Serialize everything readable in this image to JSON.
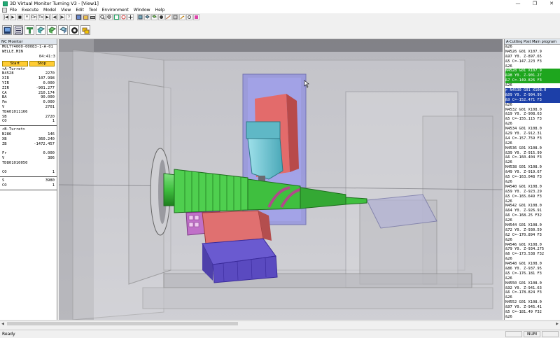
{
  "window": {
    "title": "3D Virtual Monitor Turning V3 - [View1]",
    "controls": [
      "—",
      "❐",
      "✕"
    ]
  },
  "menu": [
    "File",
    "Execute",
    "Model",
    "View",
    "Edit",
    "Tool",
    "Environment",
    "Window",
    "Help"
  ],
  "toolbar1": {
    "buttons": [
      "|◀",
      "▶",
      "■",
      "⏸",
      "On",
      "Tx",
      "▶|",
      "◀|",
      "|▶",
      "?"
    ]
  },
  "nc_monitor": {
    "title": "NC Monitor",
    "program": "MULTY4000-00083-1-A-01",
    "file": "WELLE.MIN",
    "time": "04:41:3",
    "start_label": "Start",
    "stop_label": "Stop",
    "a_turret_label": "<A-Turret>",
    "a_turret": [
      [
        "N4528",
        "2270"
      ],
      [
        "XIR",
        "107.998"
      ],
      [
        "YIR",
        "0.000"
      ],
      [
        "ZIR",
        "-901.277"
      ],
      [
        "CA",
        "210.174"
      ],
      [
        "BA",
        "90.000"
      ],
      [
        "Fm",
        "0.000"
      ],
      [
        "V",
        "2701"
      ],
      [
        "TDA01011166",
        ""
      ],
      [
        "SB",
        "2720"
      ],
      [
        "CO",
        "1"
      ]
    ],
    "b_turret_label": "<B-Turret>",
    "b_turret": [
      [
        "N286",
        "146"
      ],
      [
        "XB",
        "360.240"
      ],
      [
        "ZB",
        "-1472.457"
      ],
      [
        "",
        ""
      ],
      [
        "Fr",
        "0.000"
      ],
      [
        "V",
        "306"
      ],
      [
        "TD801010050",
        ""
      ],
      [
        "",
        ""
      ],
      [
        "CO",
        "1"
      ]
    ],
    "spindle": [
      [
        "S",
        "3980"
      ],
      [
        "CO",
        "1"
      ]
    ]
  },
  "program_panel": {
    "title": "A-Cutting Post Main program",
    "lines": [
      {
        "t": "&26",
        "h": ""
      },
      {
        "t": "N4526 G01 X107.9",
        "h": ""
      },
      {
        "t": "&97 Y0. Z-897.65",
        "h": ""
      },
      {
        "t": "&5 C=-147.223 F3",
        "h": ""
      },
      {
        "t": "&26",
        "h": ""
      },
      {
        "t": "N4528 G01 X107.9",
        "h": "green"
      },
      {
        "t": "&98 Y0. Z-901.27",
        "h": "green"
      },
      {
        "t": "&7 C=-149.826 F3",
        "h": "green"
      },
      {
        "t": "&26",
        "h": ""
      },
      {
        "t": "> N4530 G01 X108.0",
        "h": "blue"
      },
      {
        "t": "&09 Y0. Z-904.95",
        "h": "blue"
      },
      {
        "t": "&9 C=-152.471 F3",
        "h": "blue"
      },
      {
        "t": "&26",
        "h": ""
      },
      {
        "t": "N4532 G01 X108.0",
        "h": ""
      },
      {
        "t": "&19 Y0. Z-908.63",
        "h": ""
      },
      {
        "t": "&5 C=-155.115 F3",
        "h": ""
      },
      {
        "t": "&26",
        "h": ""
      },
      {
        "t": "N4534 G01 X108.0",
        "h": ""
      },
      {
        "t": "&29 Y0. Z-912.31",
        "h": ""
      },
      {
        "t": "&4 C=-157.759 F3",
        "h": ""
      },
      {
        "t": "&26",
        "h": ""
      },
      {
        "t": "N4536 G01 X108.0",
        "h": ""
      },
      {
        "t": "&39 Y0. Z-915.99",
        "h": ""
      },
      {
        "t": "&6 C=-160.404 F3",
        "h": ""
      },
      {
        "t": "&26",
        "h": ""
      },
      {
        "t": "N4538 G01 X108.0",
        "h": ""
      },
      {
        "t": "&49 Y0. Z-919.67",
        "h": ""
      },
      {
        "t": "&5 C=-163.048 F3",
        "h": ""
      },
      {
        "t": "&26",
        "h": ""
      },
      {
        "t": "N4540 G01 X108.0",
        "h": ""
      },
      {
        "t": "&59 Y0. Z-923.29",
        "h": ""
      },
      {
        "t": "&5 C=-165.649 F3",
        "h": ""
      },
      {
        "t": "&26",
        "h": ""
      },
      {
        "t": "N4542 G01 X108.0",
        "h": ""
      },
      {
        "t": "&64 Y0. Z-926.91",
        "h": ""
      },
      {
        "t": "&6 C=-168.25 F32",
        "h": ""
      },
      {
        "t": "&26",
        "h": ""
      },
      {
        "t": "N4544 G01 X108.0",
        "h": ""
      },
      {
        "t": "&72 Y0. Z-930.59",
        "h": ""
      },
      {
        "t": "&2 C=-170.894 F3",
        "h": ""
      },
      {
        "t": "&26",
        "h": ""
      },
      {
        "t": "N4546 G01 X108.0",
        "h": ""
      },
      {
        "t": "&79 Y0. Z-934.275",
        "h": ""
      },
      {
        "t": "&6 C=-173.538 F32",
        "h": ""
      },
      {
        "t": "&26",
        "h": ""
      },
      {
        "t": "N4548 G01 X108.0",
        "h": ""
      },
      {
        "t": "&86 Y0. Z-937.95",
        "h": ""
      },
      {
        "t": "&5 C=-176.181 F3",
        "h": ""
      },
      {
        "t": "&26",
        "h": ""
      },
      {
        "t": "N4550 G01 X108.0",
        "h": ""
      },
      {
        "t": "&92 Y0. Z-941.63",
        "h": ""
      },
      {
        "t": "&6 C=-178.824 F3",
        "h": ""
      },
      {
        "t": "&26",
        "h": ""
      },
      {
        "t": "N4552 G01 X108.0",
        "h": ""
      },
      {
        "t": "&97 Y0. Z-945.41",
        "h": ""
      },
      {
        "t": "&5 C=-181.49 F32",
        "h": ""
      },
      {
        "t": "&26",
        "h": ""
      }
    ]
  },
  "status": {
    "ready": "Ready",
    "num": "NUM"
  },
  "colors": {
    "workpiece": "#3fbf3f",
    "chuck_block": "#e07070",
    "tool_head": "#6fc8d6",
    "carriage": "#6a5acd",
    "highlight_green": "#1ea61e",
    "highlight_blue": "#1c3fa8",
    "run_button": "#ffcc33"
  }
}
